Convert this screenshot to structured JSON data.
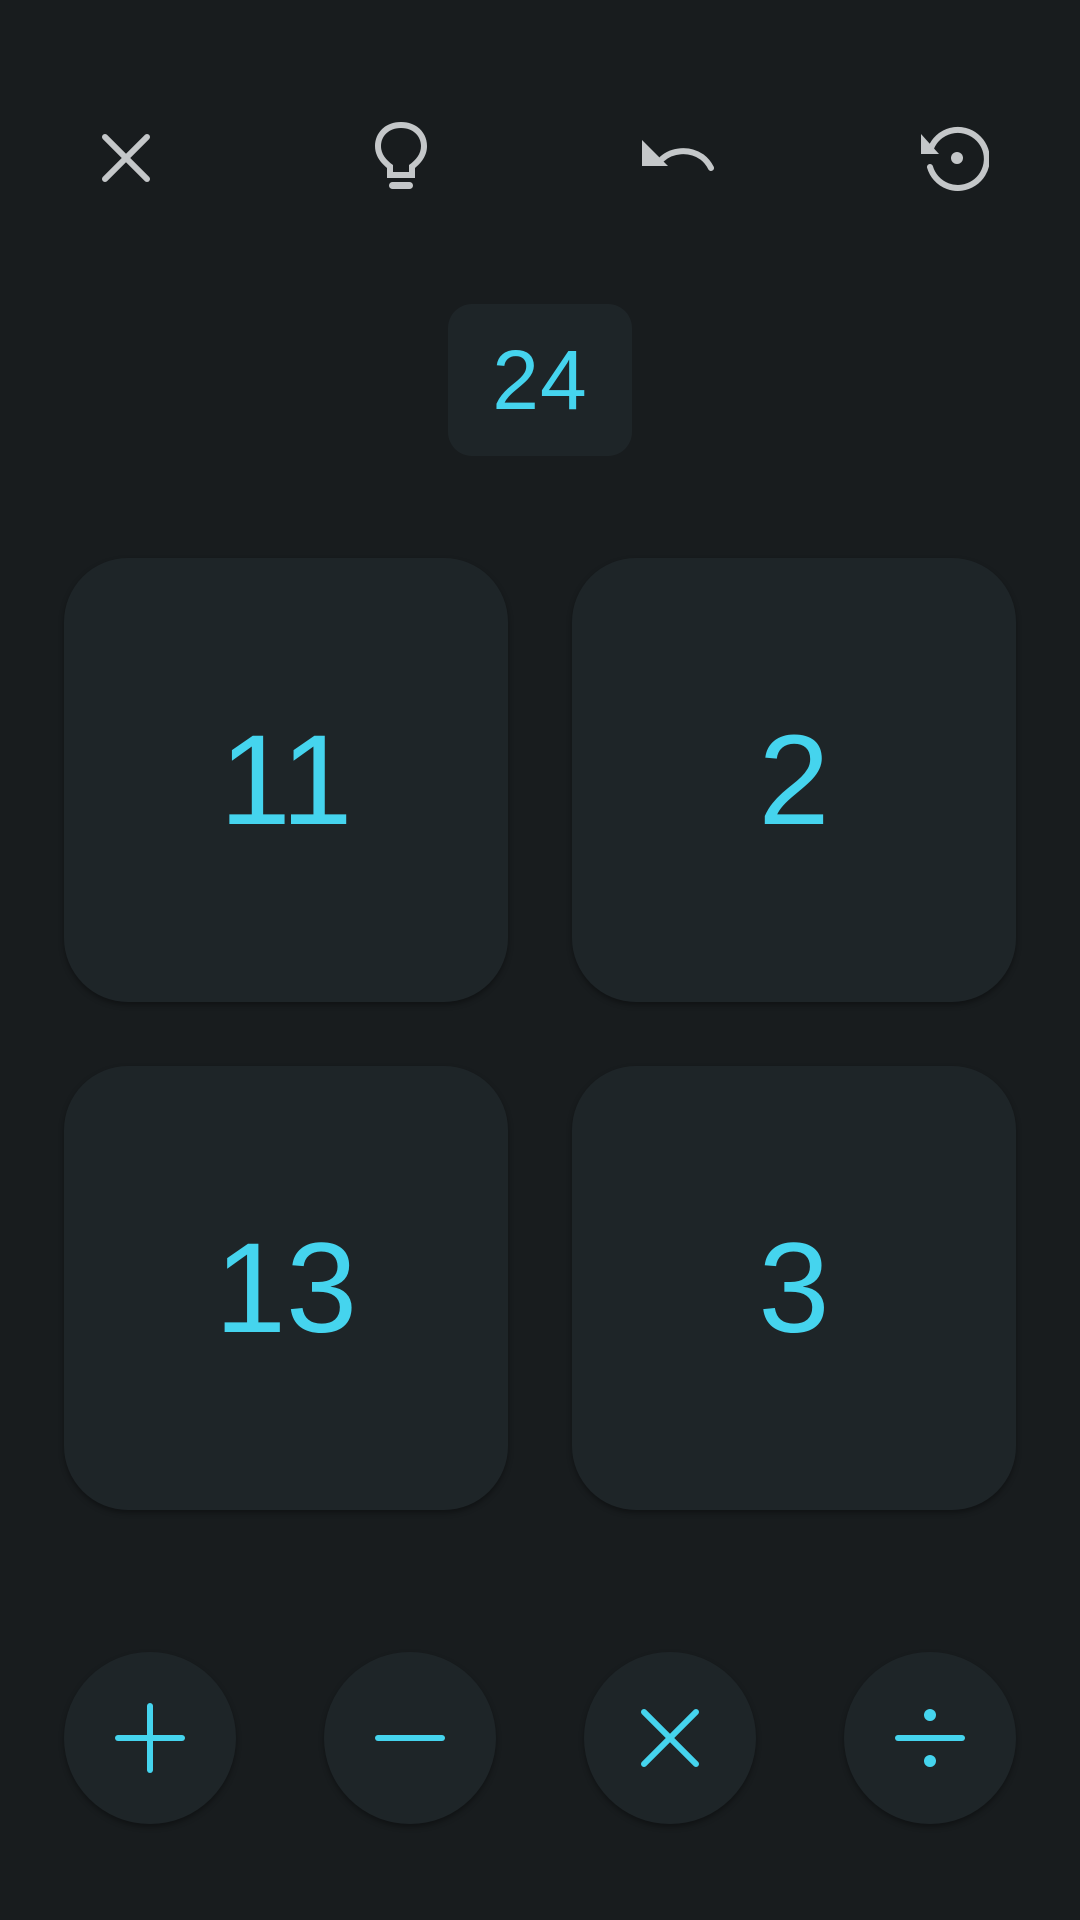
{
  "toolbar": {
    "close_icon": "close-icon",
    "hint_icon": "lightbulb-icon",
    "undo_icon": "undo-icon",
    "restart_icon": "restart-icon"
  },
  "target": {
    "value": "24"
  },
  "cards": [
    {
      "value": "11"
    },
    {
      "value": "2"
    },
    {
      "value": "13"
    },
    {
      "value": "3"
    }
  ],
  "operators": [
    {
      "name": "plus",
      "icon": "plus-icon"
    },
    {
      "name": "minus",
      "icon": "minus-icon"
    },
    {
      "name": "multiply",
      "icon": "multiply-icon"
    },
    {
      "name": "divide",
      "icon": "divide-icon"
    }
  ],
  "colors": {
    "background": "#181c1e",
    "surface": "#1e2528",
    "accent": "#45d4ee",
    "icon": "#c4c7c9"
  }
}
